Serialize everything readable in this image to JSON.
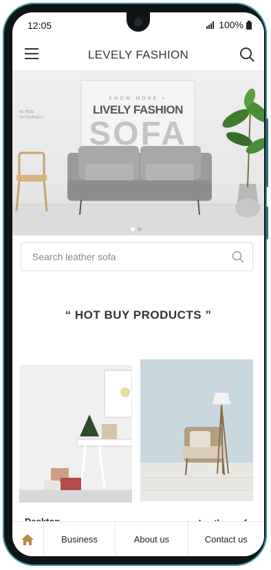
{
  "status_bar": {
    "time": "12:05",
    "battery": "100%"
  },
  "header": {
    "title": "LEVELY FASHION",
    "menu_icon": "hamburger-menu-icon",
    "search_icon": "search-icon"
  },
  "banner": {
    "kicker": "KNOW MORE +",
    "headline": "LIVELY FASHION",
    "big_word": "SOFA",
    "side_text_1": "BE TRUE",
    "side_text_2": "TO YOURSELF",
    "slide_count": 2,
    "active_slide": 1
  },
  "search": {
    "placeholder": "Search leather sofa"
  },
  "products": {
    "heading": "“ HOT BUY PRODUCTS ”",
    "items": [
      {
        "label": "Desktop... "
      },
      {
        "label": "Leather sofa"
      }
    ]
  },
  "bottom_nav": {
    "home_icon": "home-icon",
    "items": [
      "Business",
      "About us",
      "Contact us"
    ]
  },
  "colors": {
    "frame": "#0f1416",
    "frame_accent": "#3a8f9c",
    "home_icon": "#b8894a",
    "text_dark": "#333333"
  }
}
